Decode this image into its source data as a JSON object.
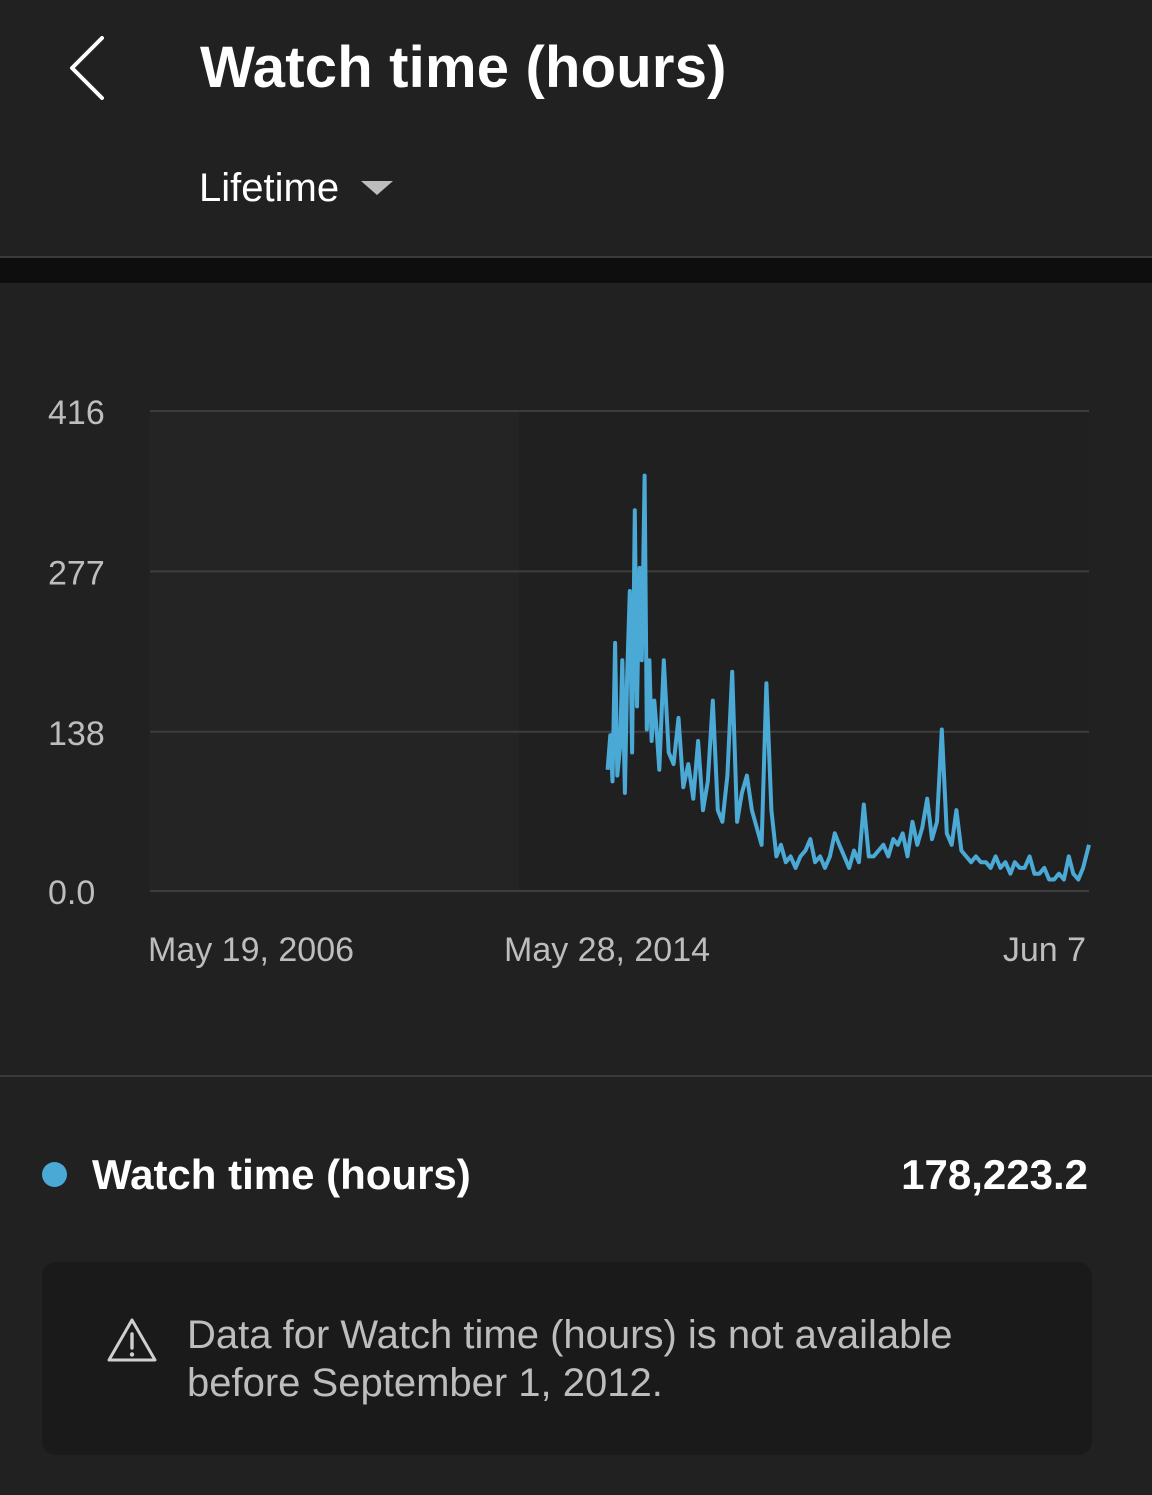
{
  "header": {
    "title": "Watch time (hours)",
    "range_label": "Lifetime",
    "back_icon": "chevron-left-icon",
    "caret_icon": "caret-down-icon"
  },
  "chart_data": {
    "type": "line",
    "title": "",
    "xlabel": "",
    "ylabel": "",
    "ylim": [
      0,
      416
    ],
    "y_ticks": [
      "416",
      "277",
      "138",
      "0.0"
    ],
    "x_tick_labels": [
      "May 19, 2006",
      "May 28, 2014",
      "Jun 7"
    ],
    "x_range": [
      "2006-05-19",
      "2022-06-07"
    ],
    "grid": true,
    "series": [
      {
        "name": "Watch time (hours)",
        "color": "#4ba9d6",
        "x": [
          "2014-03-15",
          "2014-04-01",
          "2014-04-15",
          "2014-05-01",
          "2014-05-15",
          "2014-06-01",
          "2014-06-15",
          "2014-07-01",
          "2014-07-15",
          "2014-08-01",
          "2014-08-15",
          "2014-09-01",
          "2014-09-15",
          "2014-10-01",
          "2014-10-15",
          "2014-11-01",
          "2014-11-15",
          "2014-12-01",
          "2014-12-15",
          "2015-01-01",
          "2015-01-15",
          "2015-02-01",
          "2015-03-01",
          "2015-04-01",
          "2015-05-01",
          "2015-06-01",
          "2015-07-01",
          "2015-08-01",
          "2015-09-01",
          "2015-10-01",
          "2015-11-01",
          "2015-12-01",
          "2016-01-01",
          "2016-02-01",
          "2016-03-01",
          "2016-04-01",
          "2016-05-01",
          "2016-06-01",
          "2016-07-01",
          "2016-08-01",
          "2016-09-01",
          "2016-10-01",
          "2016-11-01",
          "2016-12-01",
          "2017-01-01",
          "2017-02-01",
          "2017-03-01",
          "2017-04-01",
          "2017-05-01",
          "2017-06-01",
          "2017-07-01",
          "2017-08-01",
          "2017-09-01",
          "2017-10-01",
          "2017-11-01",
          "2017-12-01",
          "2018-01-01",
          "2018-02-01",
          "2018-03-01",
          "2018-04-01",
          "2018-05-01",
          "2018-06-01",
          "2018-07-01",
          "2018-08-01",
          "2018-09-01",
          "2018-10-01",
          "2018-11-01",
          "2018-12-01",
          "2019-01-01",
          "2019-02-01",
          "2019-03-01",
          "2019-04-01",
          "2019-05-01",
          "2019-06-01",
          "2019-07-01",
          "2019-08-01",
          "2019-09-01",
          "2019-10-01",
          "2019-11-01",
          "2019-12-01",
          "2020-01-01",
          "2020-02-01",
          "2020-03-01",
          "2020-04-01",
          "2020-05-01",
          "2020-06-01",
          "2020-07-01",
          "2020-08-01",
          "2020-09-01",
          "2020-10-01",
          "2020-11-01",
          "2020-12-01",
          "2021-01-01",
          "2021-02-01",
          "2021-03-01",
          "2021-04-01",
          "2021-05-01",
          "2021-06-01",
          "2021-07-01",
          "2021-08-01",
          "2021-09-01",
          "2021-10-01",
          "2021-11-01",
          "2021-12-01",
          "2022-01-01",
          "2022-02-01",
          "2022-03-01",
          "2022-04-01",
          "2022-05-01",
          "2022-06-07"
        ],
        "values": [
          105,
          135,
          95,
          215,
          100,
          125,
          200,
          85,
          185,
          260,
          120,
          330,
          160,
          280,
          200,
          360,
          140,
          200,
          130,
          165,
          140,
          105,
          200,
          120,
          110,
          150,
          90,
          110,
          80,
          130,
          70,
          95,
          165,
          70,
          60,
          100,
          190,
          60,
          85,
          100,
          70,
          55,
          40,
          180,
          70,
          30,
          40,
          25,
          30,
          20,
          30,
          35,
          45,
          25,
          30,
          20,
          30,
          50,
          40,
          30,
          20,
          35,
          25,
          75,
          30,
          30,
          35,
          40,
          30,
          45,
          40,
          50,
          30,
          60,
          40,
          55,
          80,
          45,
          60,
          140,
          50,
          40,
          70,
          35,
          30,
          25,
          30,
          25,
          25,
          20,
          30,
          20,
          25,
          15,
          25,
          20,
          20,
          30,
          15,
          15,
          20,
          10,
          10,
          15,
          10,
          30,
          15,
          10,
          20,
          40
        ]
      }
    ]
  },
  "legend": {
    "label": "Watch time (hours)",
    "total": "178,223.2",
    "color": "#4ba9d6"
  },
  "notice": {
    "icon": "warning-icon",
    "text": "Data for Watch time (hours) is not available before September 1, 2012."
  }
}
